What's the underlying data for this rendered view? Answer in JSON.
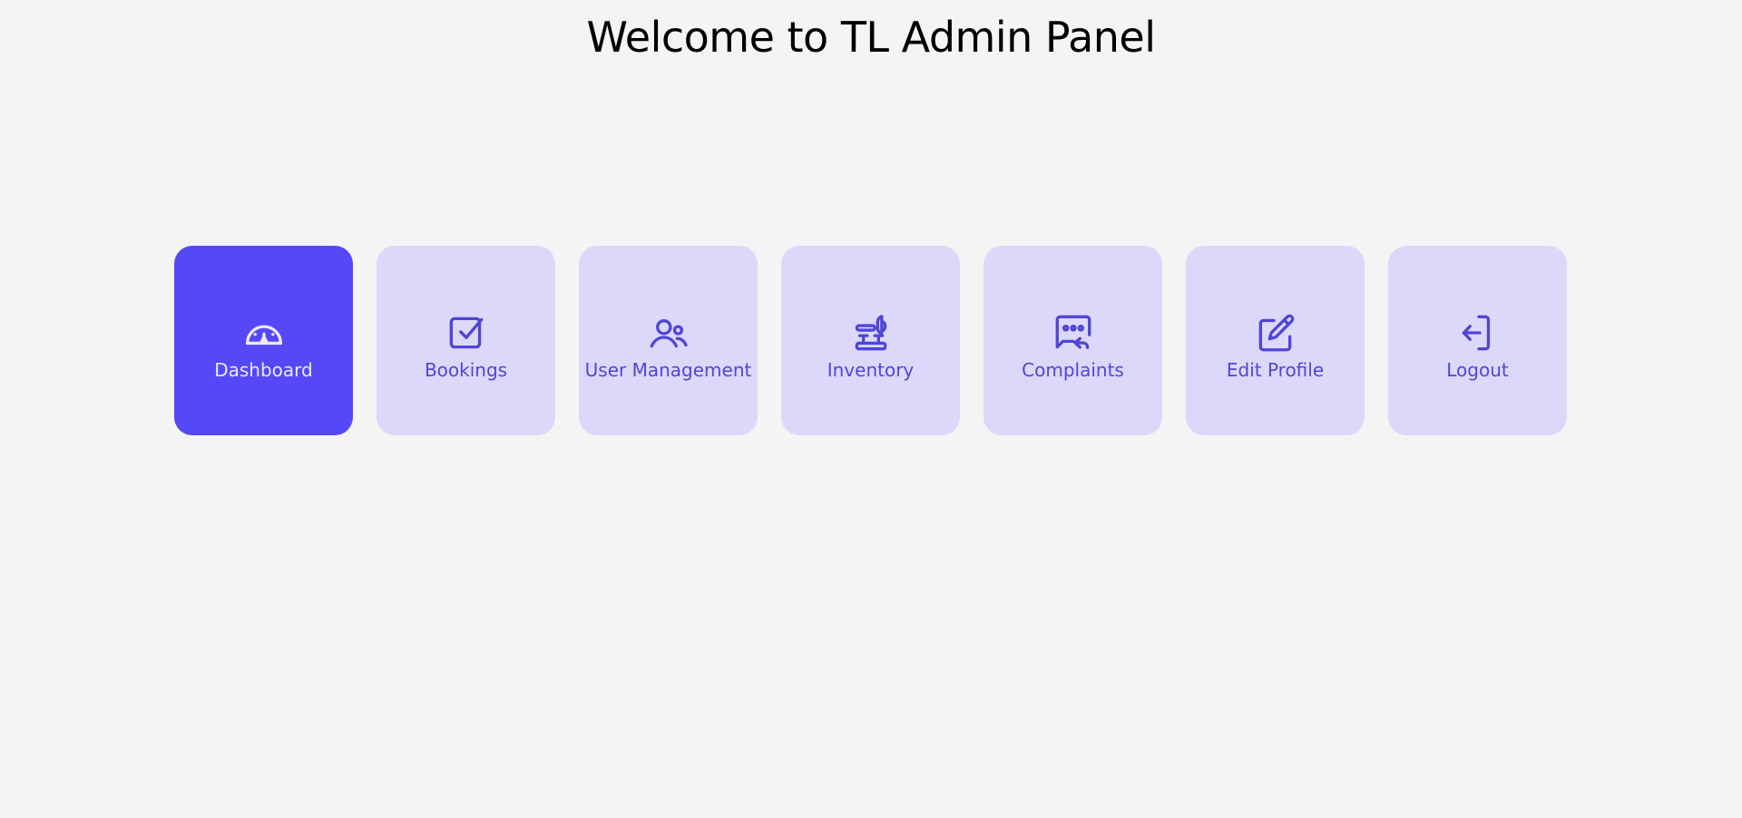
{
  "header": {
    "title": "Welcome to TL Admin Panel"
  },
  "colors": {
    "background": "#f4f4f4",
    "tile": "#dcd8fa",
    "tile_active": "#5548f6",
    "accent": "#4f46d6"
  },
  "tiles": [
    {
      "label": "Dashboard",
      "icon": "gauge-icon",
      "active": true
    },
    {
      "label": "Bookings",
      "icon": "checkbox-icon",
      "active": false
    },
    {
      "label": "User Management",
      "icon": "users-icon",
      "active": false
    },
    {
      "label": "Inventory",
      "icon": "tools-icon",
      "active": false
    },
    {
      "label": "Complaints",
      "icon": "message-reply-icon",
      "active": false
    },
    {
      "label": "Edit Profile",
      "icon": "edit-icon",
      "active": false
    },
    {
      "label": "Logout",
      "icon": "logout-icon",
      "active": false
    }
  ]
}
